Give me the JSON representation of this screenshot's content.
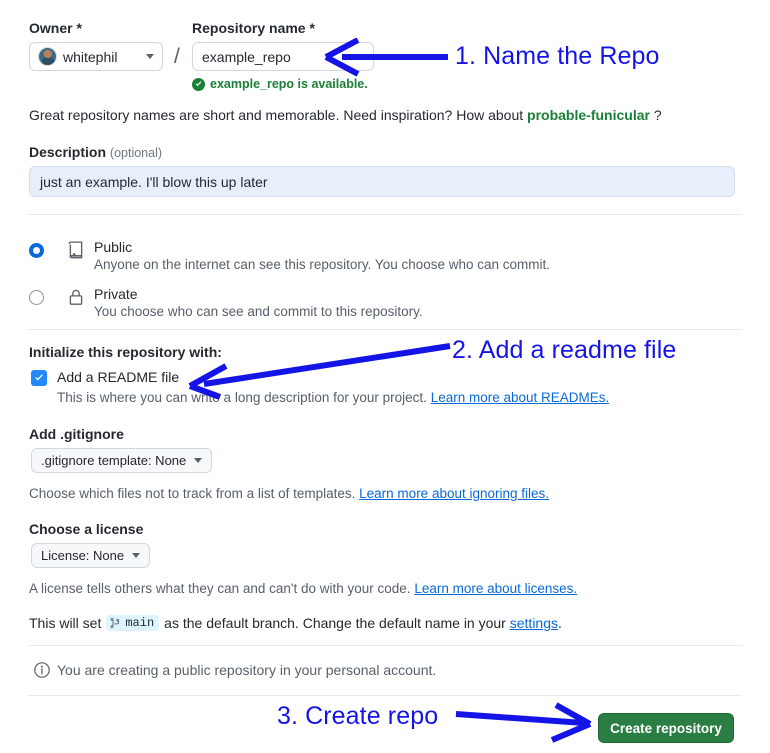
{
  "form": {
    "owner": {
      "label": "Owner *",
      "name": "whitephil",
      "avatar_icon": "user-avatar"
    },
    "separator": "/",
    "repo_name": {
      "label": "Repository name *",
      "value": "example_repo",
      "placeholder": "",
      "availability": "example_repo is available.",
      "availability_icon": "check-circle-icon"
    },
    "names_hint": {
      "prefix": "Great repository names are short and memorable. Need inspiration? How about",
      "suggestion": "probable-funicular",
      "suffix": "?"
    },
    "description": {
      "label": "Description",
      "optional": "(optional)",
      "value": "just an example. I'll blow this up later",
      "placeholder": ""
    },
    "visibility": {
      "options": [
        {
          "id": "public",
          "title": "Public",
          "subtitle": "Anyone on the internet can see this repository. You choose who can commit.",
          "icon": "repo-book-icon",
          "selected": true
        },
        {
          "id": "private",
          "title": "Private",
          "subtitle": "You choose who can see and commit to this repository.",
          "icon": "lock-icon",
          "selected": false
        }
      ]
    },
    "initialize": {
      "label": "Initialize this repository with:",
      "readme": {
        "label": "Add a README file",
        "checked": true,
        "check_icon": "checkmark-icon",
        "subtitle": "This is where you can write a long description for your project.",
        "link": "Learn more about READMEs."
      }
    },
    "gitignore": {
      "label": "Add .gitignore",
      "select_value": ".gitignore template: None",
      "caret_icon": "chevron-down-icon",
      "subtitle": "Choose which files not to track from a list of templates.",
      "link": "Learn more about ignoring files."
    },
    "license": {
      "label": "Choose a license",
      "select_value": "License: None",
      "caret_icon": "chevron-down-icon",
      "subtitle": "A license tells others what they can and can't do with your code.",
      "link": "Learn more about licenses."
    },
    "branch": {
      "prefix": "This will set",
      "chip": "main",
      "chip_icon": "git-branch-icon",
      "middle": "as the default branch. Change the default name in your",
      "link": "settings",
      "suffix": "."
    },
    "info_note": {
      "icon": "info-icon",
      "text": "You are creating a public repository in your personal account."
    },
    "submit": {
      "label": "Create repository"
    }
  },
  "annotations": [
    {
      "id": "1",
      "text": "1. Name the Repo",
      "arrow": "arrow-left-to-repo-name"
    },
    {
      "id": "2",
      "text": "2. Add a readme file",
      "arrow": "arrow-down-left-to-readme-checkbox"
    },
    {
      "id": "3",
      "text": "3. Create repo",
      "arrow": "arrow-right-to-create-button"
    }
  ],
  "colors": {
    "annotation": "#1414e6",
    "accent": "#0969da",
    "success": "#1a7f37",
    "submit_button": "#2a7d43",
    "checkbox": "#2188ff"
  }
}
